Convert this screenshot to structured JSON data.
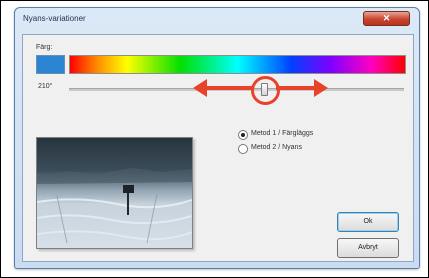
{
  "window": {
    "title": "Nyans-variationer"
  },
  "color_section": {
    "label": "Färg:",
    "swatch_color": "#2a84d2"
  },
  "hue_slider": {
    "value_label": "210°",
    "level_fraction": 0.58
  },
  "annotation": {
    "color": "#e8432a"
  },
  "methods": {
    "option1": {
      "label": "Metod 1 / Färgläggs",
      "selected": true
    },
    "option2": {
      "label": "Metod 2 / Nyans",
      "selected": false
    }
  },
  "buttons": {
    "ok": "Ok",
    "cancel": "Avbryt"
  },
  "icons": {
    "close": "close-icon"
  }
}
